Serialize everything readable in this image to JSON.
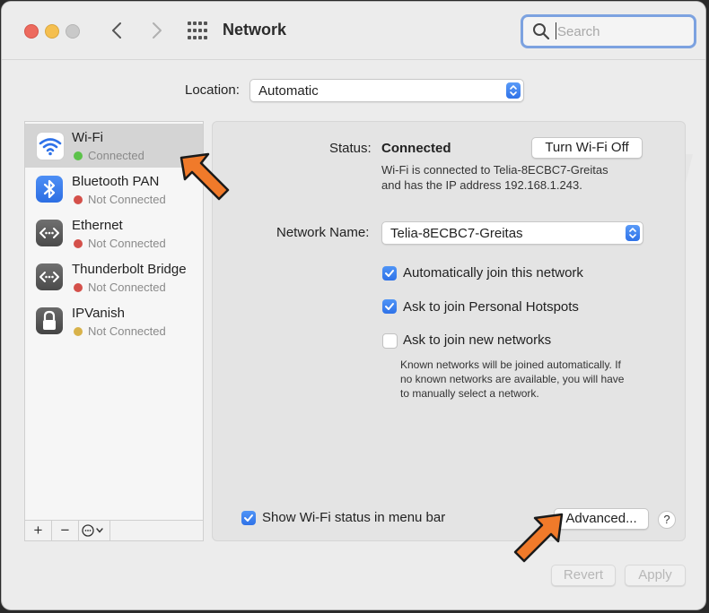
{
  "window": {
    "title": "Network",
    "search_placeholder": "Search"
  },
  "location": {
    "label": "Location:",
    "value": "Automatic"
  },
  "sidebar": {
    "items": [
      {
        "name": "Wi-Fi",
        "status": "Connected",
        "status_color": "#5cc24a",
        "icon": "wifi-icon"
      },
      {
        "name": "Bluetooth PAN",
        "status": "Not Connected",
        "status_color": "#d4504a",
        "icon": "bluetooth-icon"
      },
      {
        "name": "Ethernet",
        "status": "Not Connected",
        "status_color": "#d4504a",
        "icon": "ethernet-icon"
      },
      {
        "name": "Thunderbolt Bridge",
        "status": "Not Connected",
        "status_color": "#d4504a",
        "icon": "thunderbolt-icon"
      },
      {
        "name": "IPVanish",
        "status": "Not Connected",
        "status_color": "#d8b24a",
        "icon": "lock-icon"
      }
    ],
    "toolbar": {
      "add": "+",
      "remove": "−"
    }
  },
  "panel": {
    "status_label": "Status:",
    "status_value": "Connected",
    "turn_off_button": "Turn Wi-Fi Off",
    "status_desc_line1": "Wi-Fi is connected to Telia-8ECBC7-Greitas",
    "status_desc_line2": "and has the IP address 192.168.1.243.",
    "network_name_label": "Network Name:",
    "network_name_value": "Telia-8ECBC7-Greitas",
    "auto_join_label": "Automatically join this network",
    "auto_join_checked": true,
    "hotspots_label": "Ask to join Personal Hotspots",
    "hotspots_checked": true,
    "new_networks_label": "Ask to join new networks",
    "new_networks_checked": false,
    "known_line1": "Known networks will be joined automatically. If",
    "known_line2": "no known networks are available, you will have",
    "known_line3": "to manually select a network.",
    "show_status_label": "Show Wi-Fi status in menu bar",
    "show_status_checked": true,
    "advanced_button": "Advanced...",
    "help_button": "?"
  },
  "footer": {
    "revert_button": "Revert",
    "apply_button": "Apply"
  },
  "colors": {
    "accent": "#2f72e8",
    "annotation_arrow": "#f07a2a"
  }
}
